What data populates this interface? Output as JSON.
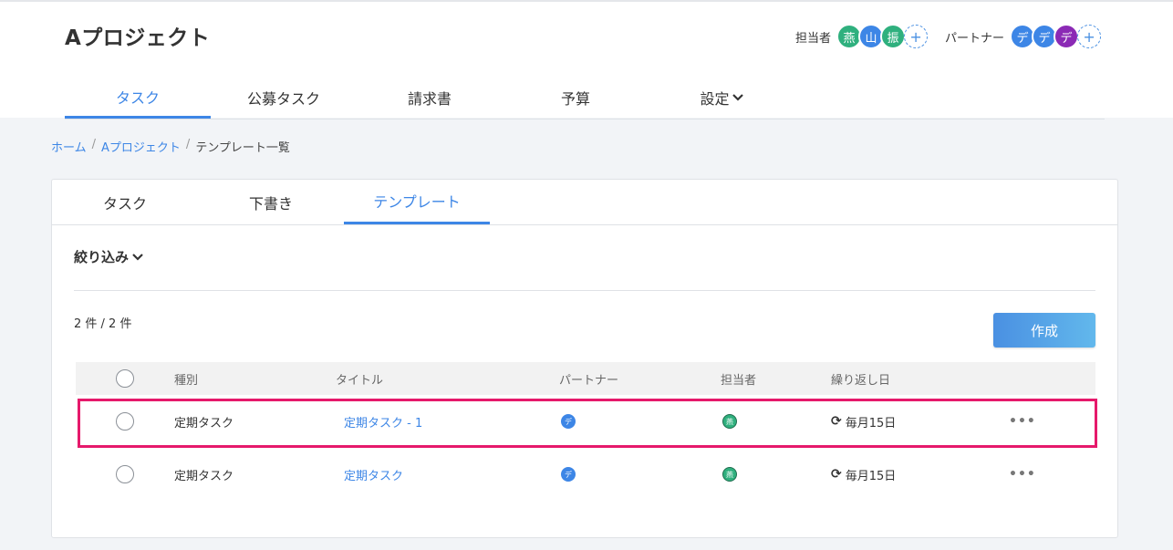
{
  "header": {
    "project_title": "Aプロジェクト",
    "assignees": {
      "label": "担当者",
      "avatars": [
        {
          "text": "燕",
          "color": "#2fb07e"
        },
        {
          "text": "山",
          "color": "#3d86e6"
        },
        {
          "text": "振",
          "color": "#2fb07e"
        }
      ]
    },
    "partners": {
      "label": "パートナー",
      "avatars": [
        {
          "text": "デ",
          "color": "#3d86e6"
        },
        {
          "text": "デ",
          "color": "#3d86e6"
        },
        {
          "text": "デ",
          "color": "#8b2ab5"
        }
      ]
    },
    "add_symbol": "+"
  },
  "nav": {
    "tabs": [
      {
        "label": "タスク",
        "active": true
      },
      {
        "label": "公募タスク",
        "active": false
      },
      {
        "label": "請求書",
        "active": false
      },
      {
        "label": "予算",
        "active": false
      },
      {
        "label": "設定",
        "active": false,
        "icon": "chevron-down-icon"
      }
    ]
  },
  "breadcrumb": {
    "items": [
      "ホーム",
      "Aプロジェクト"
    ],
    "current": "テンプレート一覧",
    "separator": "/"
  },
  "sub_tabs": [
    {
      "label": "タスク",
      "active": false
    },
    {
      "label": "下書き",
      "active": false
    },
    {
      "label": "テンプレート",
      "active": true
    }
  ],
  "filter": {
    "label": "絞り込み",
    "icon": "chevron-down-icon"
  },
  "count": "2 件 / 2 件",
  "create_button": "作成",
  "table": {
    "headers": {
      "type": "種別",
      "title": "タイトル",
      "partner": "パートナー",
      "assignee": "担当者",
      "repeat": "繰り返し日"
    },
    "rows": [
      {
        "type": "定期タスク",
        "title": "定期タスク - 1",
        "partner": "デ",
        "assignee": "燕",
        "repeat": "毎月15日",
        "highlighted": true
      },
      {
        "type": "定期タスク",
        "title": "定期タスク",
        "partner": "デ",
        "assignee": "燕",
        "repeat": "毎月15日",
        "highlighted": false
      }
    ]
  },
  "colors": {
    "accent": "#3d86e6",
    "highlight": "#e6196b",
    "green": "#2fb07e",
    "purple": "#8b2ab5"
  }
}
